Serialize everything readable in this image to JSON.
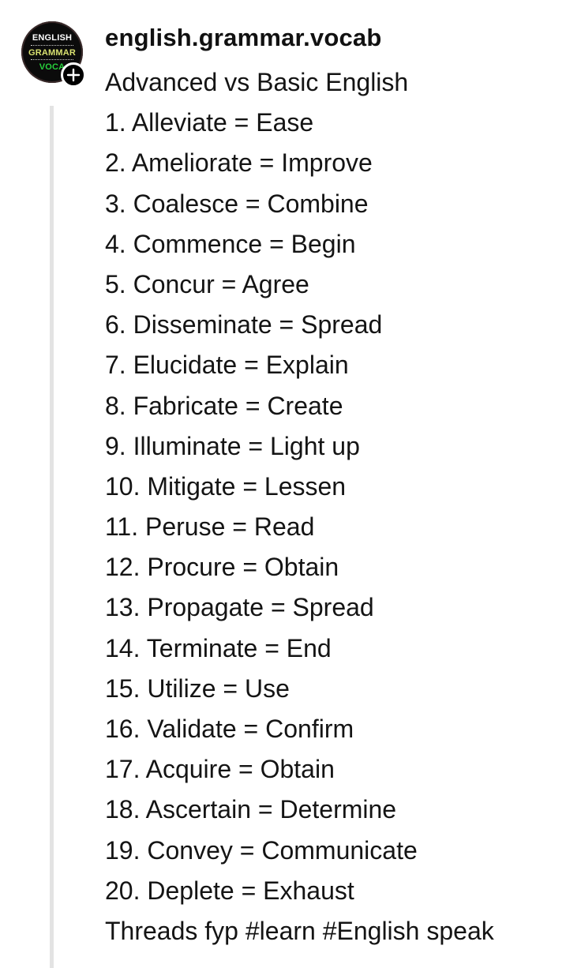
{
  "post": {
    "username": "english.grammar.vocab",
    "avatar": {
      "lines": [
        "ENGLISH",
        "GRAMMAR",
        "VOCA"
      ],
      "colors": [
        "#ffffff",
        "#d8e070",
        "#27d13c"
      ]
    },
    "follow_icon": "plus-icon",
    "title": "Advanced vs Basic English",
    "items": [
      "1. Alleviate = Ease",
      "2. Ameliorate = Improve",
      "3. Coalesce = Combine",
      "4. Commence = Begin",
      "5. Concur = Agree",
      "6. Disseminate = Spread",
      "7. Elucidate = Explain",
      "8. Fabricate = Create",
      "9. Illuminate = Light up",
      "10. Mitigate = Lessen",
      "11. Peruse = Read",
      "12. Procure = Obtain",
      "13. Propagate = Spread",
      "14. Terminate = End",
      "15. Utilize = Use",
      "16. Validate = Confirm",
      "17. Acquire = Obtain",
      "18. Ascertain = Determine",
      "19. Convey = Communicate",
      "20. Deplete = Exhaust"
    ],
    "footer": "Threads fyp #learn #English speak"
  }
}
